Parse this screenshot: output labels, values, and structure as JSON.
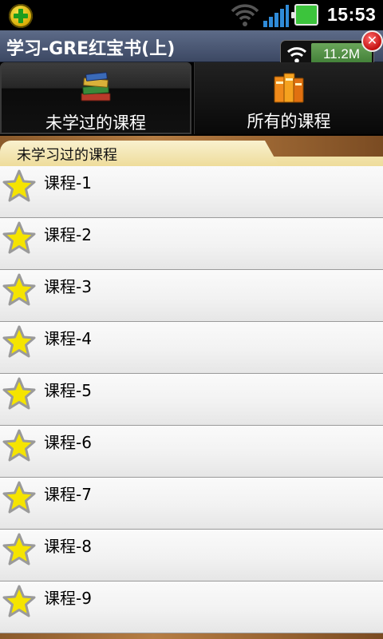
{
  "status_bar": {
    "time": "15:53"
  },
  "title_bar": {
    "title": "学习-GRE红宝书(上)"
  },
  "speed_widget": {
    "value": "11.2M"
  },
  "tabs": [
    {
      "label": "未学过的课程",
      "icon": "books-stack-icon",
      "active": true
    },
    {
      "label": "所有的课程",
      "icon": "books-upright-icon",
      "active": false
    }
  ],
  "section": {
    "title": "未学习过的课程"
  },
  "courses": [
    {
      "label": "课程-1"
    },
    {
      "label": "课程-2"
    },
    {
      "label": "课程-3"
    },
    {
      "label": "课程-4"
    },
    {
      "label": "课程-5"
    },
    {
      "label": "课程-6"
    },
    {
      "label": "课程-7"
    },
    {
      "label": "课程-8"
    },
    {
      "label": "课程-9"
    }
  ],
  "colors": {
    "title_bar": "#4a5775",
    "section_header": "#f5e9b8",
    "wood": "#a8733d",
    "star": "#f5e400"
  }
}
